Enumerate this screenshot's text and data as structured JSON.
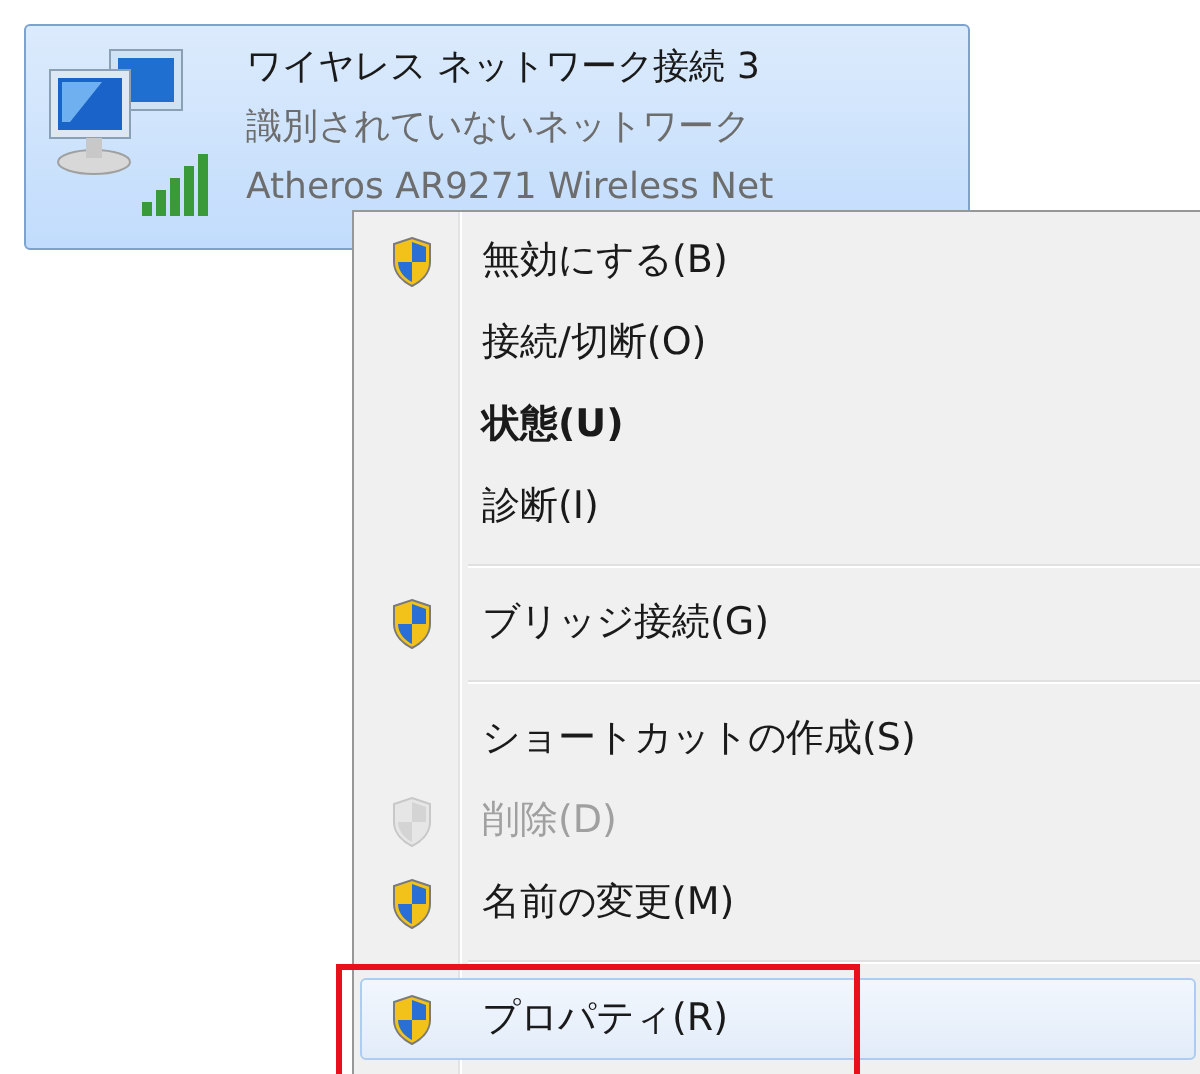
{
  "adapter": {
    "name": "ワイヤレス ネットワーク接続 3",
    "status": "識別されていないネットワーク",
    "device": "Atheros AR9271 Wireless Net",
    "selected": true
  },
  "context_menu": {
    "items": [
      {
        "kind": "item",
        "label": "無効にする(B)",
        "shield": true,
        "bold": false,
        "disabled": false,
        "selected": false,
        "outlined": false
      },
      {
        "kind": "item",
        "label": "接続/切断(O)",
        "shield": false,
        "bold": false,
        "disabled": false,
        "selected": false,
        "outlined": false
      },
      {
        "kind": "item",
        "label": "状態(U)",
        "shield": false,
        "bold": true,
        "disabled": false,
        "selected": false,
        "outlined": false
      },
      {
        "kind": "item",
        "label": "診断(I)",
        "shield": false,
        "bold": false,
        "disabled": false,
        "selected": false,
        "outlined": false
      },
      {
        "kind": "separator"
      },
      {
        "kind": "item",
        "label": "ブリッジ接続(G)",
        "shield": true,
        "bold": false,
        "disabled": false,
        "selected": false,
        "outlined": false
      },
      {
        "kind": "separator"
      },
      {
        "kind": "item",
        "label": "ショートカットの作成(S)",
        "shield": false,
        "bold": false,
        "disabled": false,
        "selected": false,
        "outlined": false
      },
      {
        "kind": "item",
        "label": "削除(D)",
        "shield": true,
        "bold": false,
        "disabled": true,
        "selected": false,
        "outlined": false
      },
      {
        "kind": "item",
        "label": "名前の変更(M)",
        "shield": true,
        "bold": false,
        "disabled": false,
        "selected": false,
        "outlined": false
      },
      {
        "kind": "separator"
      },
      {
        "kind": "item",
        "label": "プロパティ(R)",
        "shield": true,
        "bold": false,
        "disabled": false,
        "selected": true,
        "outlined": true
      }
    ]
  }
}
